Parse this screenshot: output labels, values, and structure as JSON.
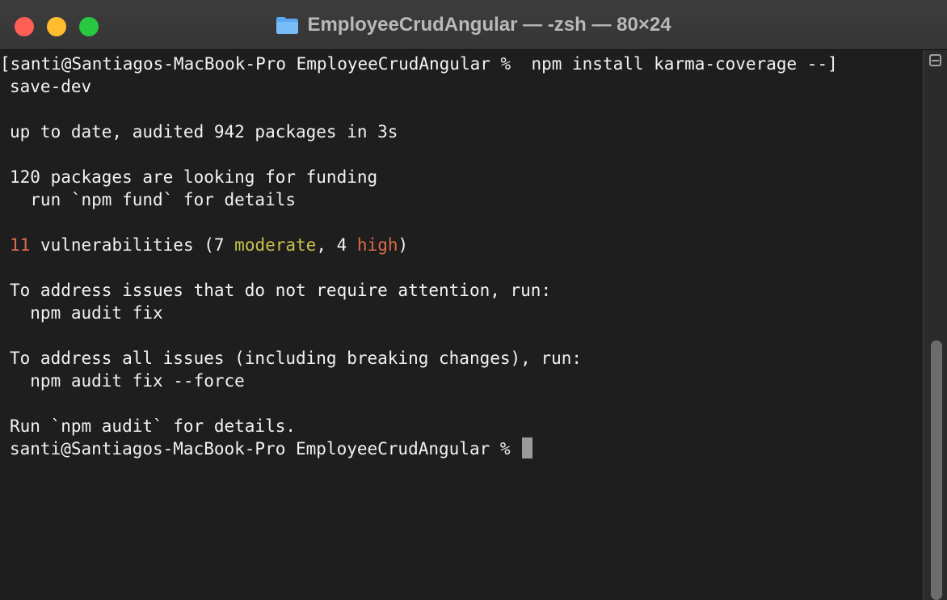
{
  "window": {
    "title": "EmployeeCrudAngular — -zsh — 80×24"
  },
  "terminal": {
    "lines": [
      "[santi@Santiagos-MacBook-Pro EmployeeCrudAngular %  npm install karma-coverage --]",
      "save-dev",
      "",
      "up to date, audited 942 packages in 3s",
      "",
      "120 packages are looking for funding",
      "  run `npm fund` for details",
      "",
      {
        "count": "11",
        "before_moderate": " vulnerabilities (7 ",
        "moderate": "moderate",
        "between": ", 4 ",
        "high": "high",
        "end": ")"
      },
      "",
      "To address issues that do not require attention, run:",
      "  npm audit fix",
      "",
      "To address all issues (including breaking changes), run:",
      "  npm audit fix --force",
      "",
      "Run `npm audit` for details.",
      "santi@Santiagos-MacBook-Pro EmployeeCrudAngular % "
    ]
  },
  "colors": {
    "background": "#1e1e1e",
    "text": "#f2f2f2",
    "vulnerability_red": "#dc6a4b",
    "moderate_yellow": "#c9c14b"
  },
  "icons": {
    "close": "close-icon",
    "minimize": "minimize-icon",
    "zoom": "zoom-icon",
    "folder": "folder-icon",
    "split_pane": "split-pane-icon"
  }
}
